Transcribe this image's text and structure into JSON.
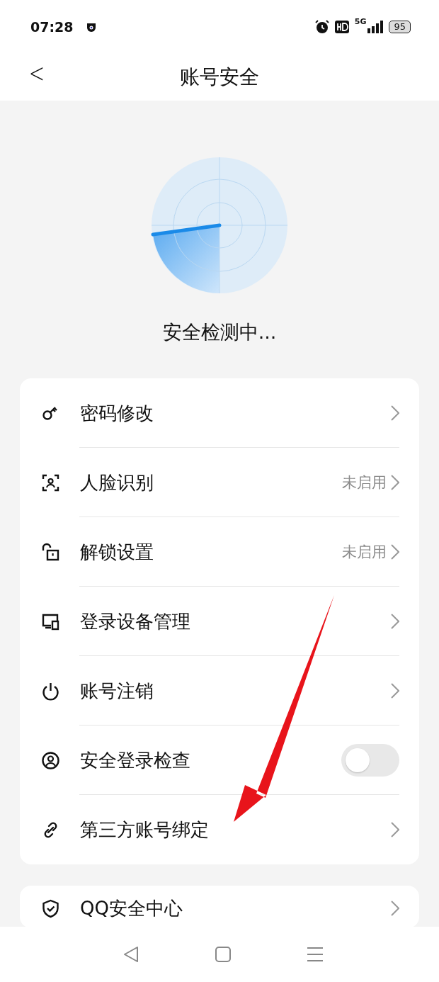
{
  "status_bar": {
    "time": "07:28",
    "network": "5G",
    "battery": "95"
  },
  "header": {
    "back": "<",
    "title": "账号安全"
  },
  "scan": {
    "caption": "安全检测中..."
  },
  "groups": [
    {
      "items": [
        {
          "kind": "link",
          "label": "密码修改"
        },
        {
          "kind": "link",
          "label": "人脸识别",
          "value": "未启用"
        },
        {
          "kind": "link",
          "label": "解锁设置",
          "value": "未启用"
        },
        {
          "kind": "link",
          "label": "登录设备管理"
        },
        {
          "kind": "link",
          "label": "账号注销"
        },
        {
          "kind": "toggle",
          "label": "安全登录检查",
          "on": false
        },
        {
          "kind": "link",
          "label": "第三方账号绑定"
        }
      ]
    },
    {
      "items": [
        {
          "kind": "link",
          "label": "QQ安全中心"
        }
      ]
    }
  ]
}
